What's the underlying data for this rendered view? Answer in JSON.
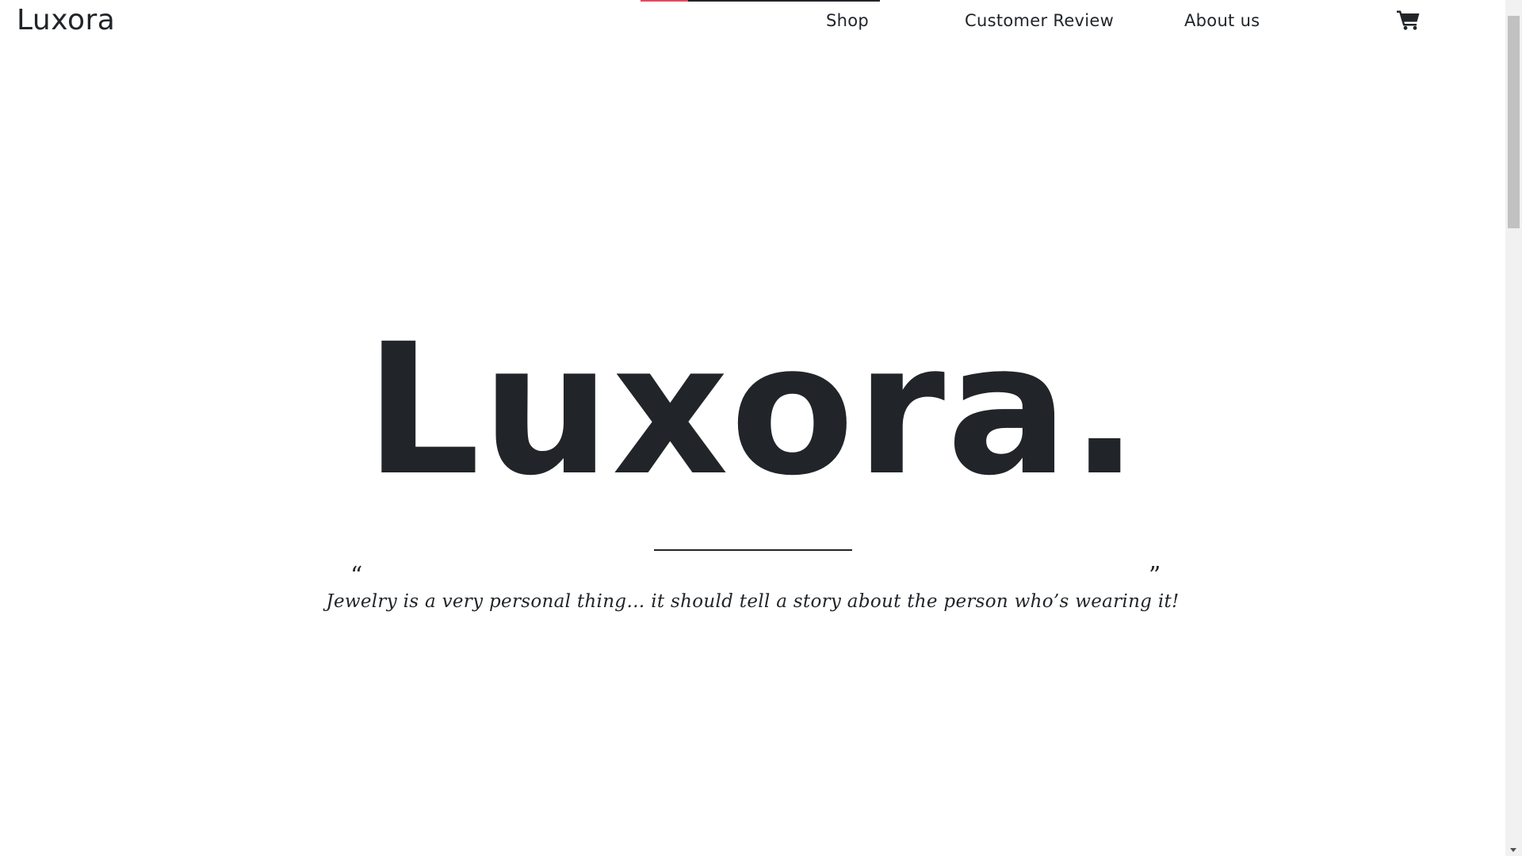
{
  "navbar": {
    "brand": "Luxora",
    "links": {
      "shop": "Shop",
      "customer_review": "Customer Review",
      "about_us": "About us"
    },
    "cart_icon": "shopping-cart-icon"
  },
  "hero": {
    "title": "Luxora.",
    "quote_open": "“",
    "quote_close": "”",
    "quote": "Jewelry is a very personal thing… it should tell a story about the person who’s wearing it!"
  },
  "colors": {
    "text": "#212529",
    "accent": "#e8495c",
    "background": "#ffffff"
  }
}
